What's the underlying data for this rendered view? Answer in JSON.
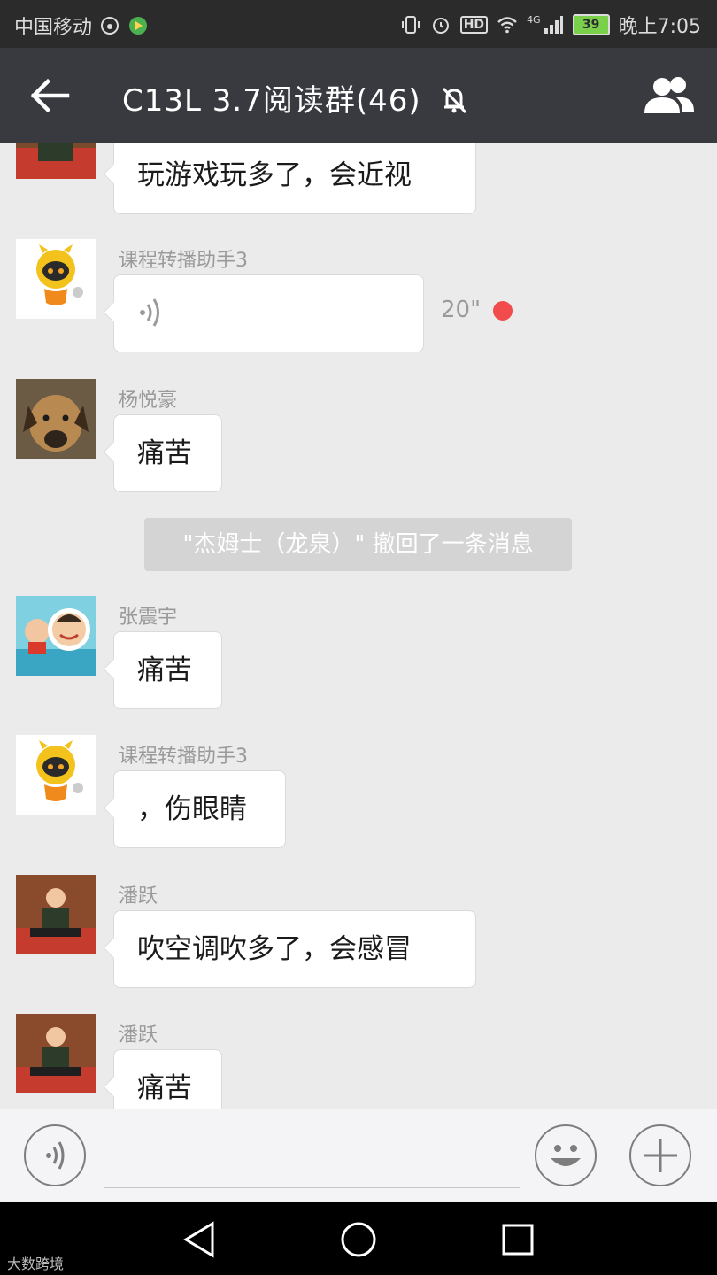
{
  "status_bar": {
    "carrier": "中国移动",
    "network": "4G",
    "hd_badge": "HD",
    "battery": "39",
    "time": "晚上7:05"
  },
  "title_bar": {
    "title": "C13L 3.7阅读群(46)",
    "back_icon": "arrow-left-icon",
    "mute_icon": "bell-muted-icon",
    "group_icon": "group-members-icon"
  },
  "messages": [
    {
      "type": "text",
      "sender": "",
      "text": "玩游戏玩多了，会近视"
    },
    {
      "type": "voice",
      "sender": "课程转播助手3",
      "duration": "20\"",
      "unread": true
    },
    {
      "type": "text",
      "sender": "杨悦豪",
      "text": "痛苦"
    },
    {
      "type": "system",
      "text": "\"杰姆士（龙泉）\" 撤回了一条消息"
    },
    {
      "type": "text",
      "sender": "张震宇",
      "text": "痛苦"
    },
    {
      "type": "text",
      "sender": "课程转播助手3",
      "text": "，伤眼睛"
    },
    {
      "type": "text",
      "sender": "潘跃",
      "text": "吹空调吹多了，会感冒"
    },
    {
      "type": "text",
      "sender": "潘跃",
      "text": "痛苦"
    }
  ],
  "input_bar": {
    "voice_icon": "voice-input-icon",
    "emoji_icon": "emoji-icon",
    "plus_icon": "plus-icon",
    "text_value": ""
  },
  "nav_bar": {
    "back_icon": "triangle-back-icon",
    "home_icon": "circle-home-icon",
    "recent_icon": "square-recent-icon"
  },
  "watermark": "大数跨境",
  "colors": {
    "title_bar": "#393a3f",
    "chat_background": "#ebebeb",
    "bubble": "#ffffff",
    "unread_dot": "#f14b4b",
    "system_message": "#d4d4d4"
  }
}
